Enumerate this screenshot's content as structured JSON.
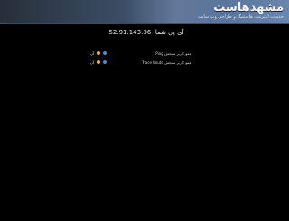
{
  "header": {
    "logo_title": "مشهدهاست",
    "logo_subtitle": "خدمات اینترنت، هاستینگ و طراحی وب سایت"
  },
  "ip_info": {
    "label": "آی پی شما:",
    "value": "52.91.143.86"
  },
  "rows": [
    {
      "label": "عمو کاربر سنجش Ping",
      "state": "آن"
    },
    {
      "label": "عمو کاربر سنجش Trace Route",
      "state": "آن"
    }
  ],
  "colors": {
    "header_start": "#27303a",
    "header_end": "#6a86ad",
    "background": "#000000",
    "icon_yellow": "#d9b43a",
    "icon_blue": "#4c89c9"
  }
}
